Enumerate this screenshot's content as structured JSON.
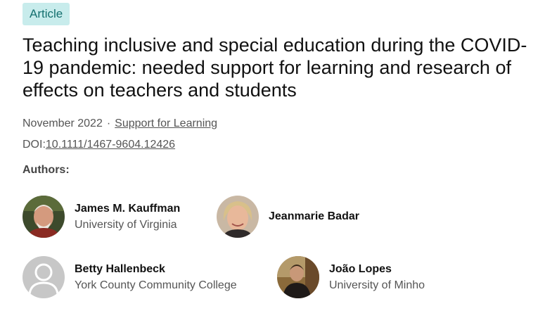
{
  "article": {
    "badge": "Article",
    "title": "Teaching inclusive and special education during the COVID-19 pandemic: needed support for learning and research of effects on teachers and students",
    "date": "November 2022",
    "separator": "·",
    "journal": "Support for Learning",
    "doi_label": "DOI:",
    "doi": "10.1111/1467-9604.12426"
  },
  "authors": {
    "heading": "Authors:",
    "list": [
      {
        "name": "James M. Kauffman",
        "affiliation": "University of Virginia",
        "avatar": "photo"
      },
      {
        "name": "Jeanmarie Badar",
        "affiliation": "",
        "avatar": "photo"
      },
      {
        "name": "Betty Hallenbeck",
        "affiliation": "York County Community College",
        "avatar": "placeholder-user-icon"
      },
      {
        "name": "João Lopes",
        "affiliation": "University of Minho",
        "avatar": "photo"
      }
    ]
  },
  "colors": {
    "badge_bg": "#c8ecec",
    "badge_text": "#14706f",
    "meta_text": "#555555"
  }
}
